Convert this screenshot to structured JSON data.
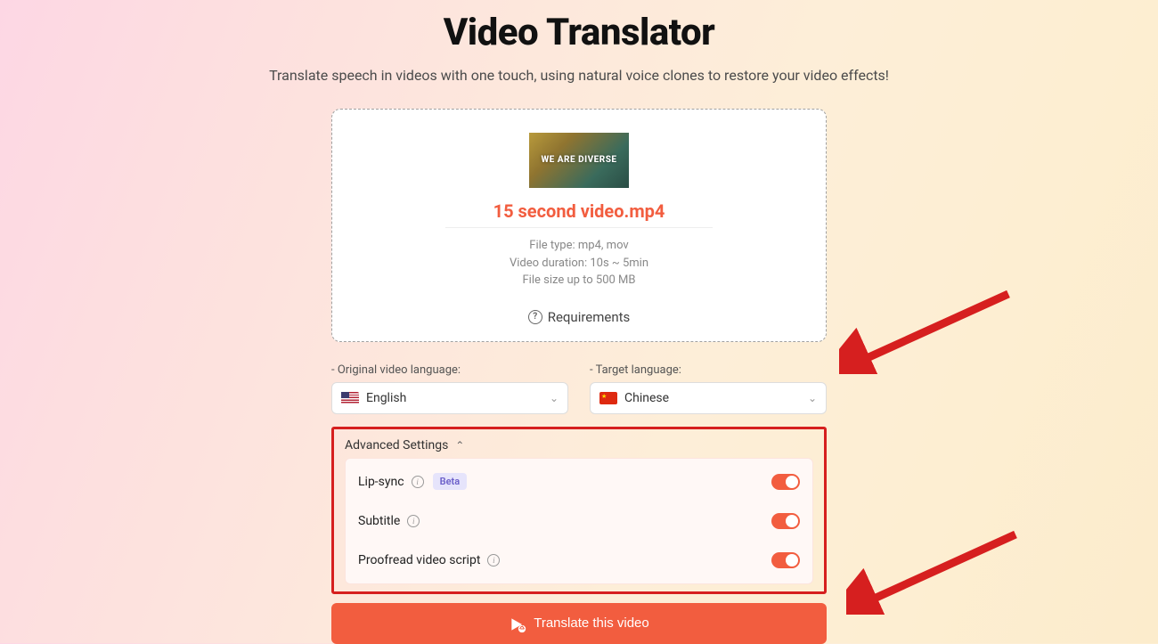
{
  "header": {
    "title": "Video Translator",
    "subtitle": "Translate speech in videos with one touch, using natural voice clones to restore your video effects!"
  },
  "upload": {
    "thumb_caption": "WE ARE DIVERSE",
    "file_name": "15 second video.mp4",
    "meta_type": "File type: mp4, mov",
    "meta_duration": "Video duration: 10s ~ 5min",
    "meta_size": "File size up to 500 MB",
    "requirements_label": "Requirements"
  },
  "languages": {
    "original": {
      "label": "- Original video language:",
      "value": "English",
      "flag": "us"
    },
    "target": {
      "label": "- Target language:",
      "value": "Chinese",
      "flag": "cn"
    }
  },
  "advanced": {
    "header": "Advanced Settings",
    "rows": [
      {
        "label": "Lip-sync",
        "info": true,
        "badge": "Beta",
        "on": true
      },
      {
        "label": "Subtitle",
        "info": true,
        "badge": null,
        "on": true
      },
      {
        "label": "Proofread video script",
        "info": true,
        "badge": null,
        "on": true
      }
    ]
  },
  "cta": {
    "label": "Translate this video"
  }
}
